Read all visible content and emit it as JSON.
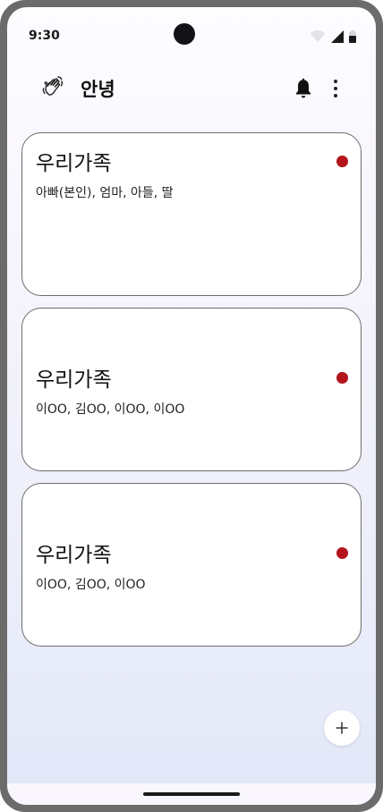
{
  "status_bar": {
    "time": "9:30"
  },
  "app_bar": {
    "title": "안녕",
    "leading_icon": "waving-hand-icon",
    "actions": [
      "bell-icon",
      "more-vert-icon"
    ]
  },
  "groups": [
    {
      "title": "우리가족",
      "members": "아빠(본인), 엄마, 아들, 딸",
      "indicator_color": "#b3151c"
    },
    {
      "title": "우리가족",
      "members": "이OO, 김OO, 이OO, 이OO",
      "indicator_color": "#b3151c"
    },
    {
      "title": "우리가족",
      "members": "이OO, 김OO, 이OO",
      "indicator_color": "#b3151c"
    }
  ],
  "fab": {
    "icon": "plus-icon"
  },
  "colors": {
    "accent_dot": "#b3151c",
    "card_border": "#6c6c6c"
  }
}
